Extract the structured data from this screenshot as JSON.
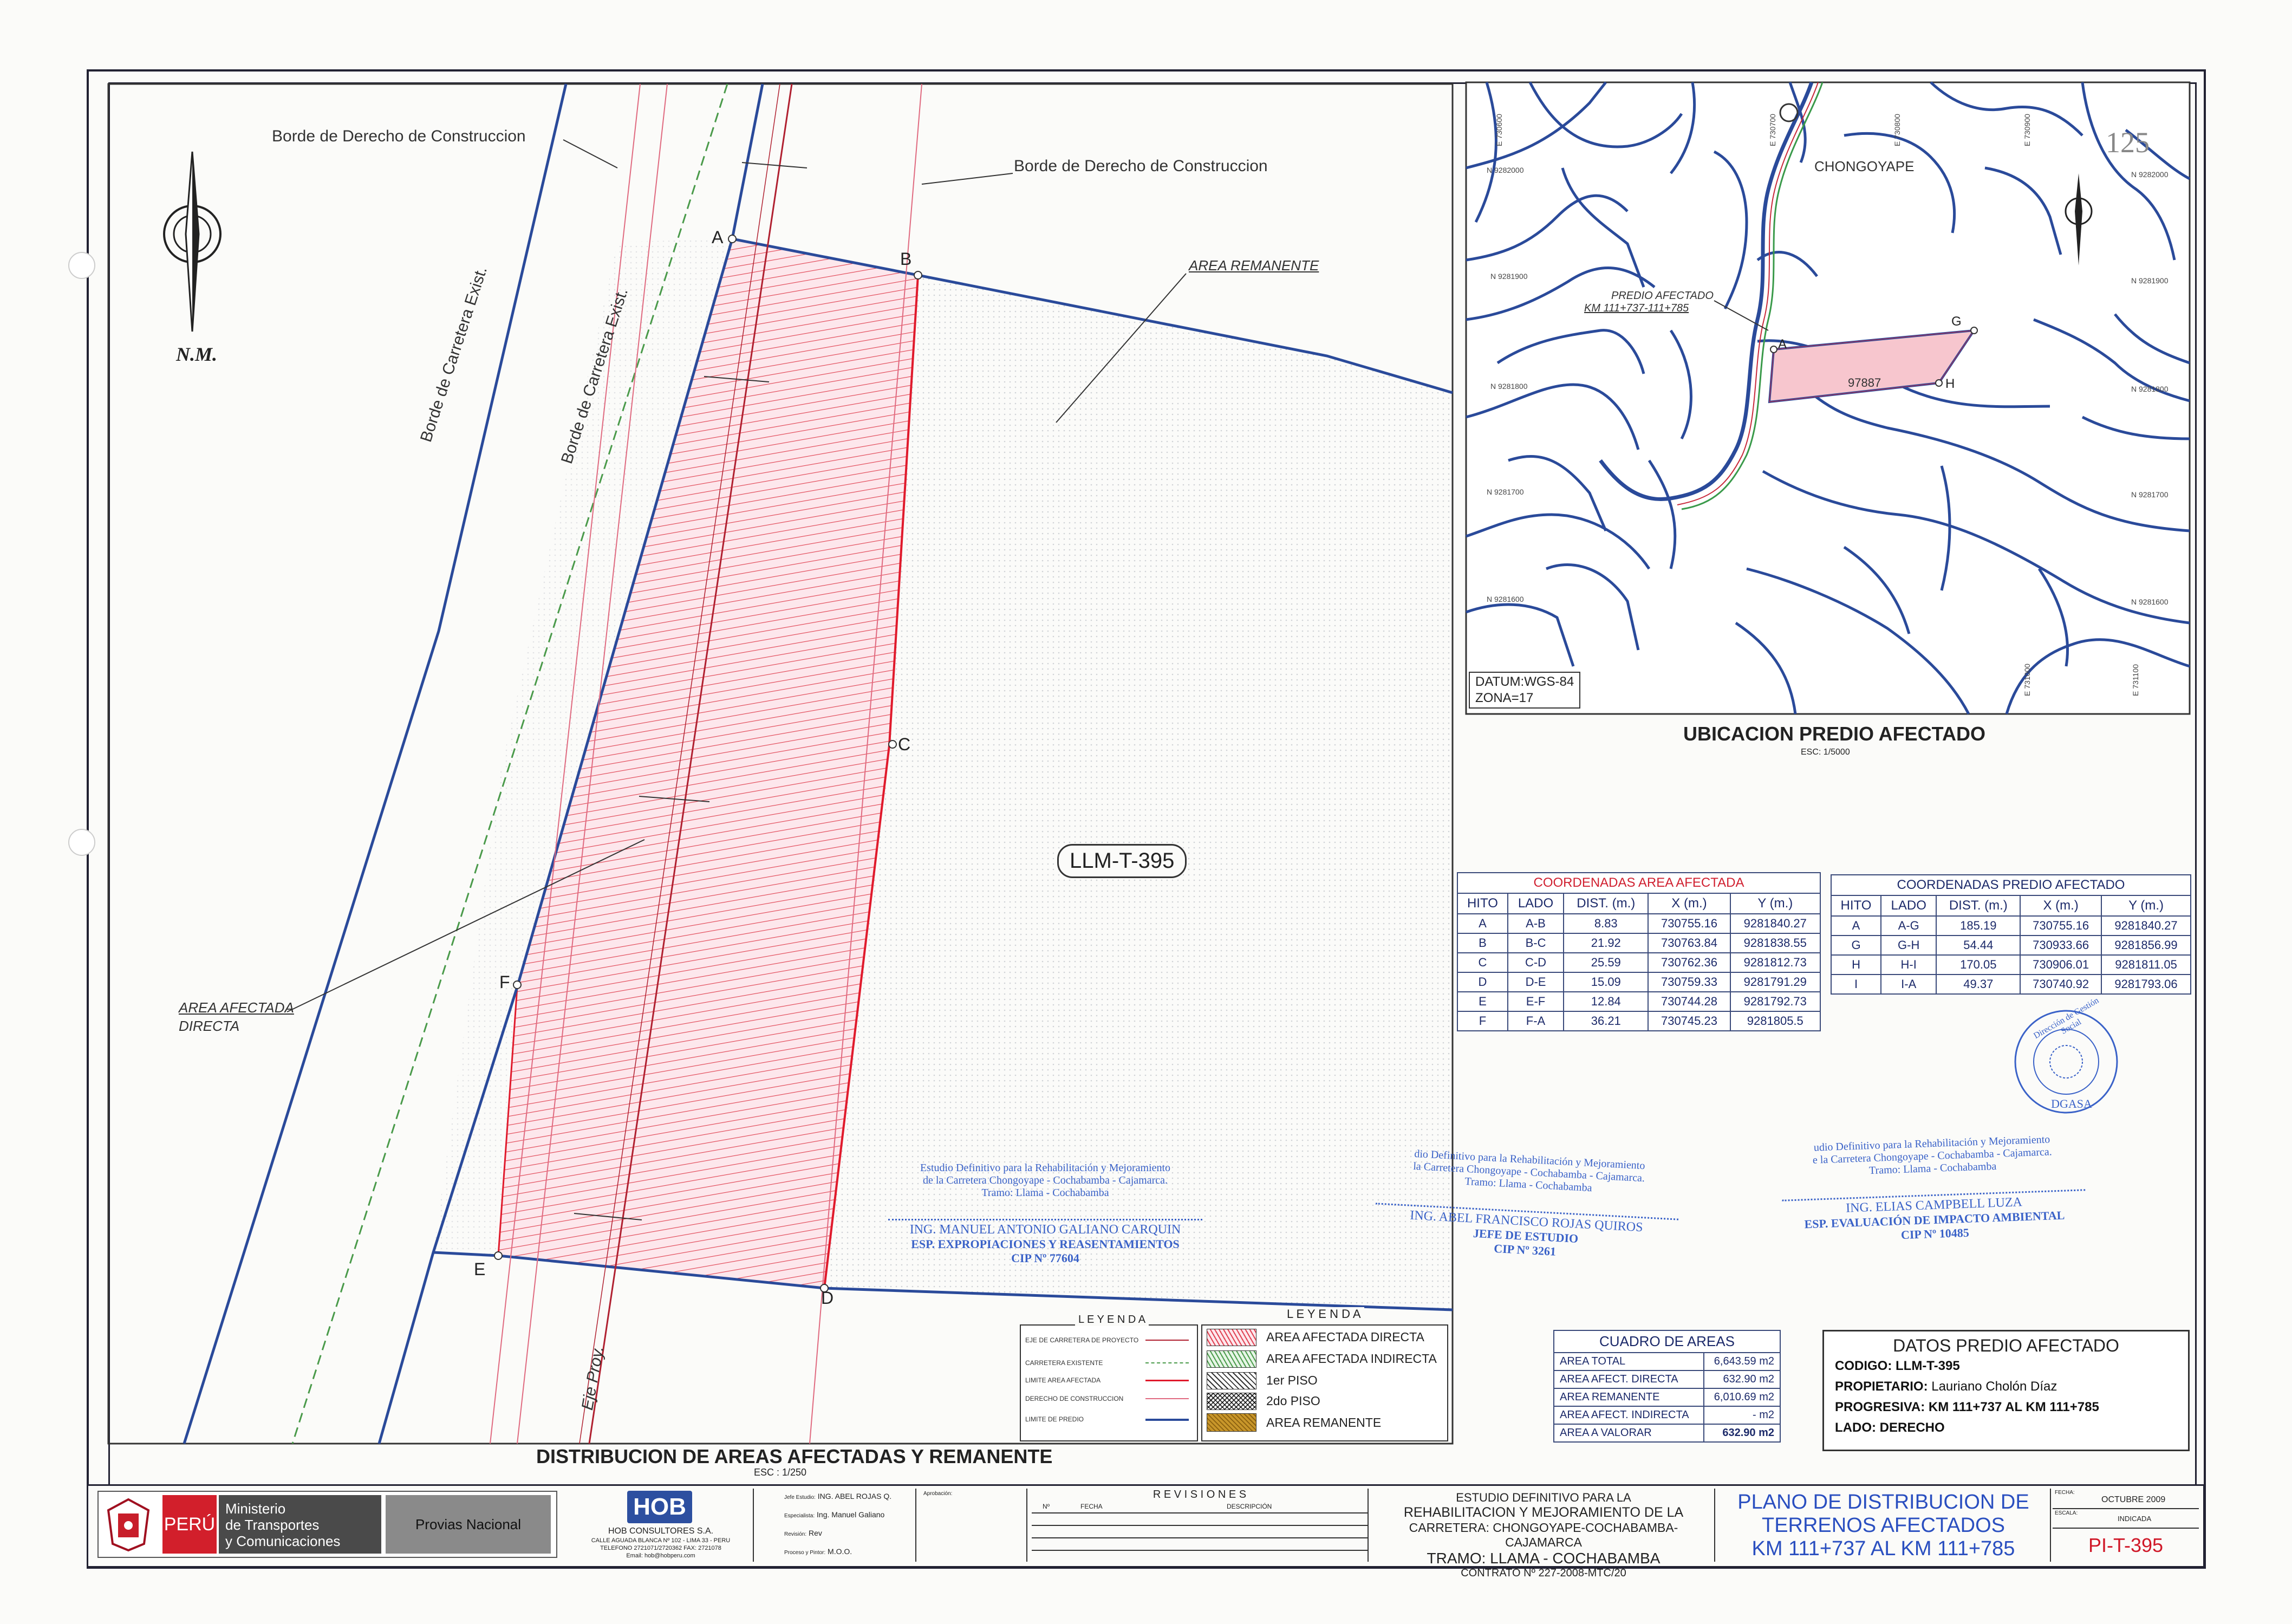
{
  "main_plan": {
    "north_label": "N.M.",
    "borde_top_left": "Borde de Derecho de Construccion",
    "borde_top_right": "Borde de Derecho de Construccion",
    "area_remanente_label": "AREA REMANENTE",
    "area_afectada_label_1": "AREA AFECTADA",
    "area_afectada_label_2": "DIRECTA",
    "borde_carretera_1": "Borde de Carretera Exist.",
    "borde_carretera_2": "Borde de Carretera Exist.",
    "eje_proy": "Eje Proy.",
    "parcel_code": "LLM-T-395",
    "points": {
      "A": "A",
      "B": "B",
      "C": "C",
      "D": "D",
      "E": "E",
      "F": "F"
    },
    "title": "DISTRIBUCION DE AREAS AFECTADAS Y REMANENTE",
    "scale": "ESC : 1/250"
  },
  "location_map": {
    "town": "CHONGOYAPE",
    "sheet_number": "125",
    "predio_label_1": "PREDIO AFECTADO",
    "predio_label_2": "KM 111+737-111+785",
    "lot_number": "97887",
    "point_A": "A",
    "point_G": "G",
    "point_H": "H",
    "datum_1": "DATUM:WGS-84",
    "datum_2": "ZONA=17",
    "title": "UBICACION PREDIO AFECTADO",
    "scale": "ESC: 1/5000",
    "grid_n": [
      "N 9282000",
      "N 9281900",
      "N 9281800",
      "N 9281700",
      "N 9281600"
    ],
    "grid_e": [
      "E 730600",
      "E 730700",
      "E 730800",
      "E 730900",
      "E 731000",
      "E 731100"
    ]
  },
  "coord_afectada": {
    "title": "COORDENADAS AREA AFECTADA",
    "headers": [
      "HITO",
      "LADO",
      "DIST. (m.)",
      "X (m.)",
      "Y (m.)"
    ],
    "rows": [
      [
        "A",
        "A-B",
        "8.83",
        "730755.16",
        "9281840.27"
      ],
      [
        "B",
        "B-C",
        "21.92",
        "730763.84",
        "9281838.55"
      ],
      [
        "C",
        "C-D",
        "25.59",
        "730762.36",
        "9281812.73"
      ],
      [
        "D",
        "D-E",
        "15.09",
        "730759.33",
        "9281791.29"
      ],
      [
        "E",
        "E-F",
        "12.84",
        "730744.28",
        "9281792.73"
      ],
      [
        "F",
        "F-A",
        "36.21",
        "730745.23",
        "9281805.5"
      ]
    ]
  },
  "coord_predio": {
    "title": "COORDENADAS PREDIO AFECTADO",
    "headers": [
      "HITO",
      "LADO",
      "DIST. (m.)",
      "X (m.)",
      "Y (m.)"
    ],
    "rows": [
      [
        "A",
        "A-G",
        "185.19",
        "730755.16",
        "9281840.27"
      ],
      [
        "G",
        "G-H",
        "54.44",
        "730933.66",
        "9281856.99"
      ],
      [
        "H",
        "H-I",
        "170.05",
        "730906.01",
        "9281811.05"
      ],
      [
        "I",
        "I-A",
        "49.37",
        "730740.92",
        "9281793.06"
      ]
    ]
  },
  "leyenda_left": {
    "title": "L E Y E N D A",
    "items": [
      "EJE DE CARRETERA DE PROYECTO",
      "CARRETERA EXISTENTE",
      "LIMITE AREA AFECTADA",
      "DERECHO DE CONSTRUCCION",
      "LIMITE DE PREDIO"
    ]
  },
  "leyenda_right": {
    "title": "L E Y E N D A",
    "items": [
      "AREA AFECTADA DIRECTA",
      "AREA AFECTADA INDIRECTA",
      "1er PISO",
      "2do PISO",
      "AREA REMANENTE"
    ]
  },
  "cuadro_areas": {
    "title": "CUADRO DE AREAS",
    "rows": [
      [
        "AREA TOTAL",
        "6,643.59 m2"
      ],
      [
        "AREA AFECT. DIRECTA",
        "632.90 m2"
      ],
      [
        "AREA REMANENTE",
        "6,010.69 m2"
      ],
      [
        "AREA AFECT. INDIRECTA",
        "- m2"
      ],
      [
        "AREA A VALORAR",
        "632.90 m2"
      ]
    ]
  },
  "datos_predio": {
    "title": "DATOS PREDIO AFECTADO",
    "codigo_label": "CODIGO:",
    "codigo": "LLM-T-395",
    "propietario_label": "PROPIETARIO:",
    "propietario": "Lauriano Cholón Díaz",
    "progresiva_label": "PROGRESIVA:",
    "progresiva": "KM 111+737 AL KM 111+785",
    "lado_label": "LADO:",
    "lado": "DERECHO"
  },
  "stamps": {
    "s1_l1": "Estudio Definitivo para la Rehabilitación y Mejoramiento",
    "s1_l2": "de la Carretera Chongoyape - Cochabamba - Cajamarca.",
    "s1_l3": "Tramo: Llama - Cochabamba",
    "s1_name": "ING. MANUEL ANTONIO GALIANO CARQUIN",
    "s1_role": "ESP. EXPROPIACIONES Y REASENTAMIENTOS",
    "s1_cip": "CIP Nº 77604",
    "s2_l1": "dio Definitivo para la Rehabilitación y Mejoramiento",
    "s2_l2": "la Carretera Chongoyape - Cochabamba - Cajamarca.",
    "s2_l3": "Tramo: Llama - Cochabamba",
    "s2_name": "ING. ABEL FRANCISCO ROJAS QUIROS",
    "s2_role": "JEFE DE ESTUDIO",
    "s2_cip": "CIP Nº 3261",
    "s3_l1": "udio Definitivo para la Rehabilitación y Mejoramiento",
    "s3_l2": "e la Carretera Chongoyape - Cochabamba - Cajamarca.",
    "s3_l3": "Tramo: Llama - Cochabamba",
    "s3_name": "ING. ELIAS CAMPBELL LUZA",
    "s3_role": "ESP. EVALUACIÓN DE IMPACTO AMBIENTAL",
    "s3_cip": "CIP Nº 10485",
    "seal_outer": "Dirección de Gestión Social",
    "seal_inner": "DGASA"
  },
  "title_block": {
    "peru": "PERÚ",
    "ministerio_1": "Ministerio",
    "ministerio_2": "de Transportes",
    "ministerio_3": "y Comunicaciones",
    "provias": "Provias Nacional",
    "hob": "HOB",
    "hob_name": "HOB CONSULTORES S.A.",
    "hob_addr": "CALLE AGUADA BLANCA Nº 102 - LIMA 33 - PERU",
    "hob_tel": "TELEFONO 2721071/2720362 FAX: 2721078",
    "hob_email": "Email: hob@hobperu.com",
    "jefe_label": "Jefe Estudio:",
    "jefe": "ING. ABEL ROJAS Q.",
    "esp_label": "Especialista:",
    "esp": "Ing. Manuel Galiano",
    "rev_label": "Revisión:",
    "rev": "Rev",
    "proc_label": "Proceso y Pintor:",
    "proc": "M.O.O.",
    "aprob_label": "Aprobación:",
    "revisiones": "R E V I S I O N E S",
    "rev_cols": [
      "Nº",
      "FECHA",
      "DESCRIPCIÓN"
    ],
    "estudio_1": "ESTUDIO DEFINITIVO PARA LA",
    "estudio_2": "REHABILITACION Y MEJORAMIENTO DE LA",
    "estudio_3": "CARRETERA: CHONGOYAPE-COCHABAMBA-CAJAMARCA",
    "estudio_4": "TRAMO: LLAMA - COCHABAMBA",
    "contrato": "CONTRATO Nº 227-2008-MTC/20",
    "plano_1": "PLANO DE DISTRIBUCION DE",
    "plano_2": "TERRENOS AFECTADOS",
    "plano_3": "KM 111+737 AL KM 111+785",
    "fecha_label": "FECHA:",
    "fecha": "OCTUBRE 2009",
    "escala_label": "ESCALA:",
    "escala": "INDICADA",
    "plano_code": "PI-T-395"
  }
}
